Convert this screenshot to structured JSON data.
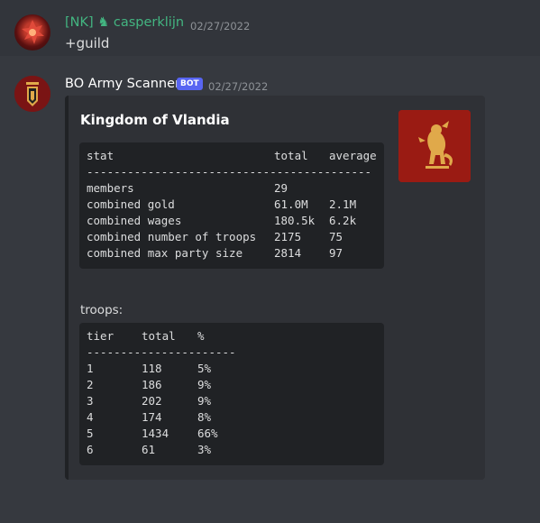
{
  "message1": {
    "username": "[NK] ♞ casperklijn",
    "timestamp": "02/27/2022",
    "content": "+guild"
  },
  "message2": {
    "username": "BO Army Scanner",
    "bot_tag": "BOT",
    "timestamp": "02/27/2022",
    "embed": {
      "title": "Kingdom of Vlandia",
      "stats_table": {
        "headers": [
          "stat",
          "total",
          "average"
        ],
        "divider": "------------------------------------------",
        "rows": [
          [
            "members",
            "29",
            ""
          ],
          [
            "combined gold",
            "61.0M",
            "2.1M"
          ],
          [
            "combined wages",
            "180.5k",
            "6.2k"
          ],
          [
            "combined number of troops",
            "2175",
            "75"
          ],
          [
            "combined max party size",
            "2814",
            "97"
          ]
        ]
      },
      "troops_label": "troops:",
      "troops_table": {
        "headers": [
          "tier",
          "total",
          "%"
        ],
        "divider": "----------------------",
        "rows": [
          [
            "1",
            "118",
            "5%"
          ],
          [
            "2",
            "186",
            "9%"
          ],
          [
            "3",
            "202",
            "9%"
          ],
          [
            "4",
            "174",
            "8%"
          ],
          [
            "5",
            "1434",
            "66%"
          ],
          [
            "6",
            "61",
            "3%"
          ]
        ]
      }
    }
  },
  "colors": {
    "background": "#36393f",
    "username_green": "#43b581",
    "bot_tag": "#5865f2",
    "embed_bg": "#2f3136",
    "codeblock_bg": "#202225",
    "banner_red": "#9a1b13",
    "lion_gold": "#e0a94a"
  },
  "icons": {
    "user1_avatar": "red-dragon-avatar",
    "user2_avatar": "vlandia-banner-avatar",
    "role_icon": "knight-icon",
    "thumbnail": "vlandia-lion-banner"
  }
}
